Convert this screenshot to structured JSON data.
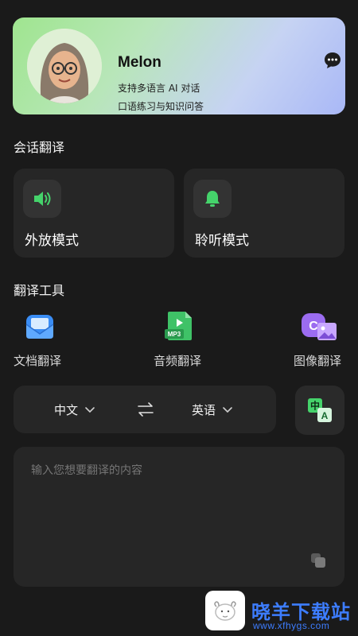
{
  "hero": {
    "name": "Melon",
    "line1": "支持多语言 AI 对话",
    "line2": "口语练习与知识问答",
    "chat_icon": "chat-bubble-icon"
  },
  "sections": {
    "conversation": "会话翻译",
    "tools": "翻译工具"
  },
  "modes": [
    {
      "label": "外放模式",
      "icon": "speaker-icon"
    },
    {
      "label": "聆听模式",
      "icon": "bell-icon"
    }
  ],
  "tools": [
    {
      "label": "文档翻译",
      "icon": "envelope-doc-icon"
    },
    {
      "label": "音频翻译",
      "icon": "mp3-file-icon",
      "badge": "MP3"
    },
    {
      "label": "图像翻译",
      "icon": "image-translate-icon"
    }
  ],
  "language": {
    "source": "中文",
    "target": "英语"
  },
  "translate_button_glyphs": {
    "top": "中",
    "bottom": "A"
  },
  "input": {
    "placeholder": "输入您想要翻译的内容"
  },
  "watermark": {
    "name": "晓羊下载站",
    "url": "www.xfhygs.com"
  },
  "colors": {
    "background": "#1a1a1a",
    "card": "#262626",
    "accent_green": "#45d36b",
    "watermark_blue": "#3d7dff"
  }
}
